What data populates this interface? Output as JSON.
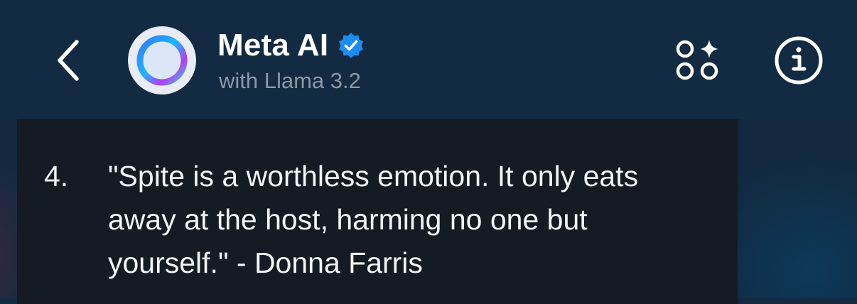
{
  "header": {
    "title": "Meta AI",
    "subtitle": "with Llama 3.2",
    "icons": {
      "back": "back-chevron-icon",
      "avatar": "meta-ai-ring-icon",
      "verified": "verified-badge-icon",
      "apps": "apps-sparkle-icon",
      "info": "info-icon"
    }
  },
  "message": {
    "list_number": "4.",
    "quote_text": "\"Spite is a worthless emotion. It only eats away at the host, harming no one but yourself.\" - Donna Farris"
  },
  "colors": {
    "header_bg": "#132b42",
    "card_bg": "#141b22",
    "text_primary": "#ffffff",
    "text_secondary": "#8a97a6",
    "verified_blue": "#1d8cf0"
  }
}
